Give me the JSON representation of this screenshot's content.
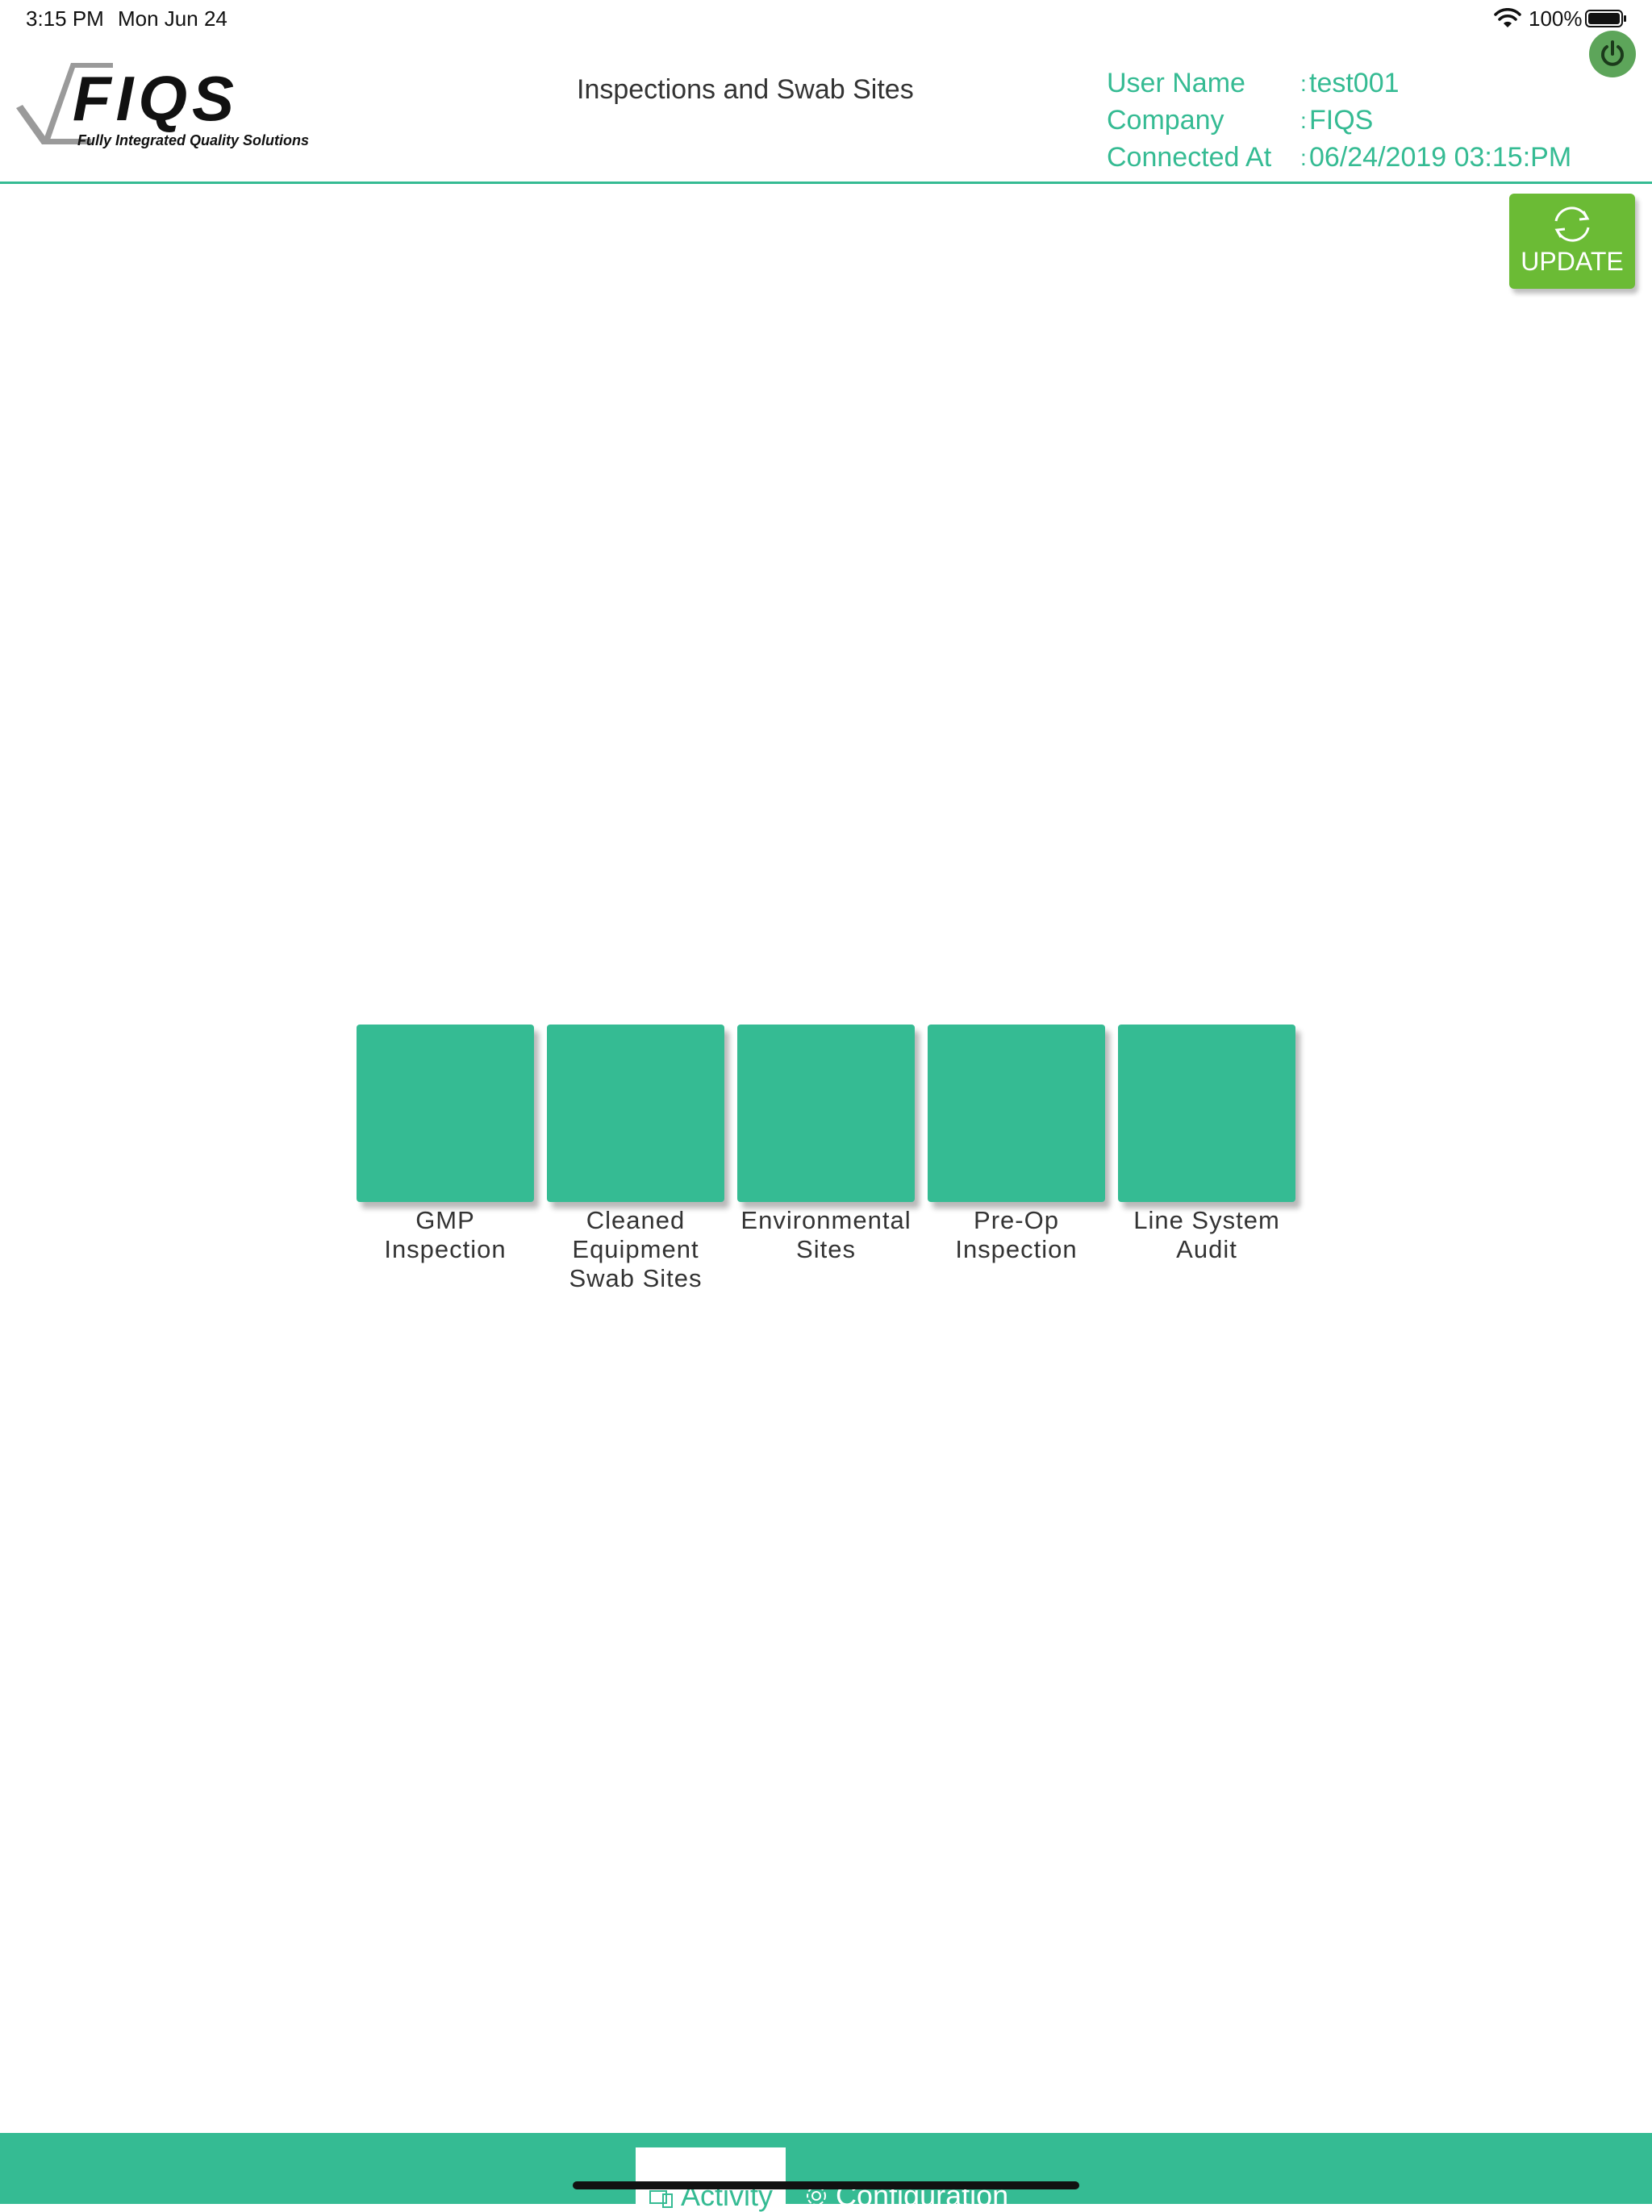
{
  "status_bar": {
    "time": "3:15 PM",
    "date": "Mon Jun 24",
    "battery": "100%"
  },
  "header": {
    "logo_text": "FIQS",
    "logo_tagline": "Fully Integrated Quality Solutions",
    "title": "Inspections and Swab Sites",
    "info": [
      {
        "label": "User Name",
        "value": "test001"
      },
      {
        "label": "Company",
        "value": "FIQS"
      },
      {
        "label": "Connected At",
        "value": "06/24/2019 03:15:PM"
      }
    ],
    "separator": ":"
  },
  "update_button": {
    "label": "UPDATE"
  },
  "tiles": [
    {
      "label_lines": [
        "GMP",
        "Inspection"
      ]
    },
    {
      "label_lines": [
        "Cleaned",
        "Equipment",
        "Swab Sites"
      ]
    },
    {
      "label_lines": [
        "Environmental",
        "Sites"
      ]
    },
    {
      "label_lines": [
        "Pre-Op",
        "Inspection"
      ]
    },
    {
      "label_lines": [
        "Line System",
        "Audit"
      ]
    }
  ],
  "tab_bar": {
    "tabs": [
      {
        "label": "Activity",
        "icon": "activity-icon",
        "selected": true
      },
      {
        "label": "Configuration",
        "icon": "gear-icon",
        "selected": false
      }
    ]
  },
  "colors": {
    "accent": "#35bb93",
    "update_green": "#6bbb35",
    "power_green": "#5da55a"
  }
}
